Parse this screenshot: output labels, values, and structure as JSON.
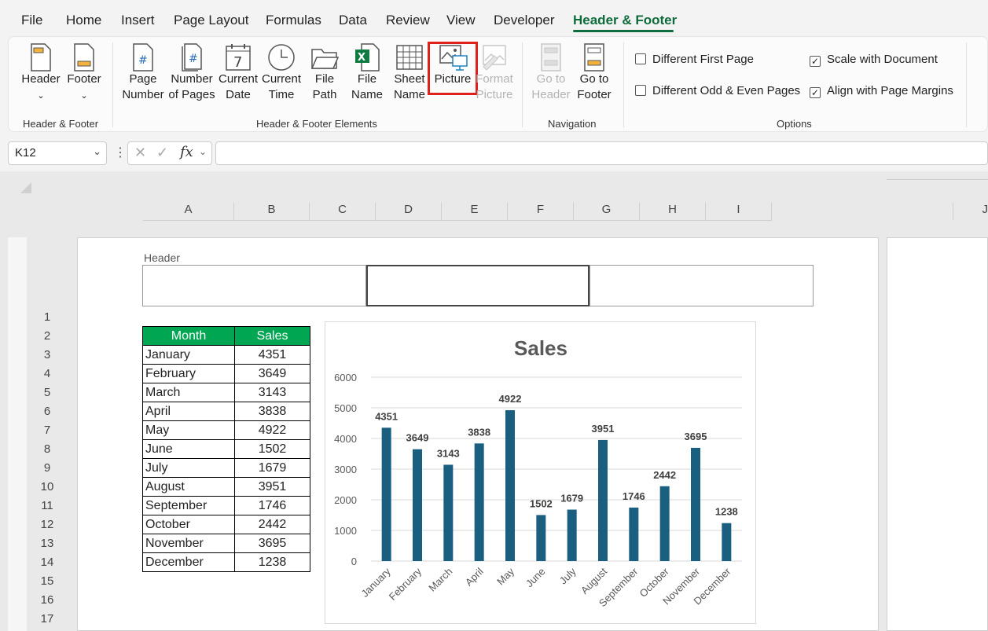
{
  "menu": {
    "tabs": [
      "File",
      "Home",
      "Insert",
      "Page Layout",
      "Formulas",
      "Data",
      "Review",
      "View",
      "Developer",
      "Header & Footer"
    ],
    "active": "Header & Footer"
  },
  "ribbon": {
    "header_footer_group": {
      "label": "Header & Footer",
      "header": "Header",
      "footer": "Footer"
    },
    "elements_group": {
      "label": "Header & Footer Elements",
      "page_number": [
        "Page",
        "Number"
      ],
      "number_of_pages": [
        "Number",
        "of Pages"
      ],
      "current_date": [
        "Current",
        "Date"
      ],
      "current_time": [
        "Current",
        "Time"
      ],
      "file_path": [
        "File",
        "Path"
      ],
      "file_name": [
        "File",
        "Name"
      ],
      "sheet_name": [
        "Sheet",
        "Name"
      ],
      "picture": "Picture",
      "format_picture": [
        "Format",
        "Picture"
      ]
    },
    "navigation_group": {
      "label": "Navigation",
      "go_to_header": [
        "Go to",
        "Header"
      ],
      "go_to_footer": [
        "Go to",
        "Footer"
      ]
    },
    "options_group": {
      "label": "Options",
      "different_first_page": {
        "label": "Different First Page",
        "checked": false
      },
      "different_odd_even": {
        "label": "Different Odd & Even Pages",
        "checked": false
      },
      "scale_with_document": {
        "label": "Scale with Document",
        "checked": true
      },
      "align_with_margins": {
        "label": "Align with Page Margins",
        "checked": true
      }
    }
  },
  "formula_bar": {
    "name_box": "K12",
    "fx": "fx",
    "formula": ""
  },
  "sheet": {
    "columns": [
      "A",
      "B",
      "C",
      "D",
      "E",
      "F",
      "G",
      "H",
      "I",
      "J"
    ],
    "rows": [
      "1",
      "2",
      "3",
      "4",
      "5",
      "6",
      "7",
      "8",
      "9",
      "10",
      "11",
      "12",
      "13",
      "14",
      "15",
      "16",
      "17"
    ],
    "header_label": "Header",
    "table": {
      "headers": [
        "Month",
        "Sales"
      ],
      "rows": [
        [
          "January",
          "4351"
        ],
        [
          "February",
          "3649"
        ],
        [
          "March",
          "3143"
        ],
        [
          "April",
          "3838"
        ],
        [
          "May",
          "4922"
        ],
        [
          "June",
          "1502"
        ],
        [
          "July",
          "1679"
        ],
        [
          "August",
          "3951"
        ],
        [
          "September",
          "1746"
        ],
        [
          "October",
          "2442"
        ],
        [
          "November",
          "3695"
        ],
        [
          "December",
          "1238"
        ]
      ]
    }
  },
  "colors": {
    "accent": "#0e6b3b",
    "table_header": "#00a651",
    "bar": "#1a5f80",
    "highlight": "#e0201b"
  },
  "chart_data": {
    "type": "bar",
    "title": "Sales",
    "categories": [
      "January",
      "February",
      "March",
      "April",
      "May",
      "June",
      "July",
      "August",
      "September",
      "October",
      "November",
      "December"
    ],
    "values": [
      4351,
      3649,
      3143,
      3838,
      4922,
      1502,
      1679,
      3951,
      1746,
      2442,
      3695,
      1238
    ],
    "yticks": [
      0,
      1000,
      2000,
      3000,
      4000,
      5000,
      6000
    ],
    "ylim": [
      0,
      6000
    ],
    "grid": true,
    "xlabel": "",
    "ylabel": ""
  }
}
